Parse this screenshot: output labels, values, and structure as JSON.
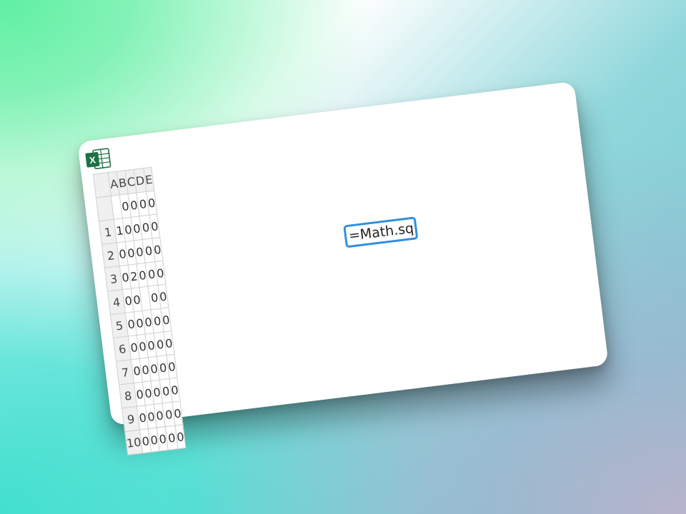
{
  "app": {
    "icon": "excel-icon",
    "icon_letter": "X",
    "icon_color": "#1e7145"
  },
  "grid": {
    "columns": [
      "A",
      "B",
      "C",
      "D",
      "E"
    ],
    "rows": [
      {
        "header": "",
        "cells": [
          "",
          "0",
          "0",
          "0",
          "0"
        ]
      },
      {
        "header": "1",
        "cells": [
          "1",
          "0",
          "0",
          "0",
          "0"
        ]
      },
      {
        "header": "2",
        "cells": [
          "0",
          "0",
          "0",
          "0",
          "0"
        ]
      },
      {
        "header": "3",
        "cells": [
          "0",
          "2",
          "0",
          "0",
          "0"
        ]
      },
      {
        "header": "4",
        "cells": [
          "0",
          "0",
          "",
          "0",
          "0"
        ]
      },
      {
        "header": "5",
        "cells": [
          "0",
          "0",
          "0",
          "0",
          "0"
        ]
      },
      {
        "header": "6",
        "cells": [
          "0",
          "0",
          "0",
          "0",
          "0"
        ]
      },
      {
        "header": "7",
        "cells": [
          "0",
          "0",
          "0",
          "0",
          "0"
        ]
      },
      {
        "header": "8",
        "cells": [
          "0",
          "0",
          "0",
          "0",
          "0"
        ]
      },
      {
        "header": "9",
        "cells": [
          "0",
          "0",
          "0",
          "0",
          "0"
        ]
      },
      {
        "header": "10",
        "cells": [
          "0",
          "0",
          "0",
          "0",
          "0"
        ]
      }
    ]
  },
  "editor": {
    "value": "=Math.sq",
    "border_color": "#2f8fe0"
  }
}
